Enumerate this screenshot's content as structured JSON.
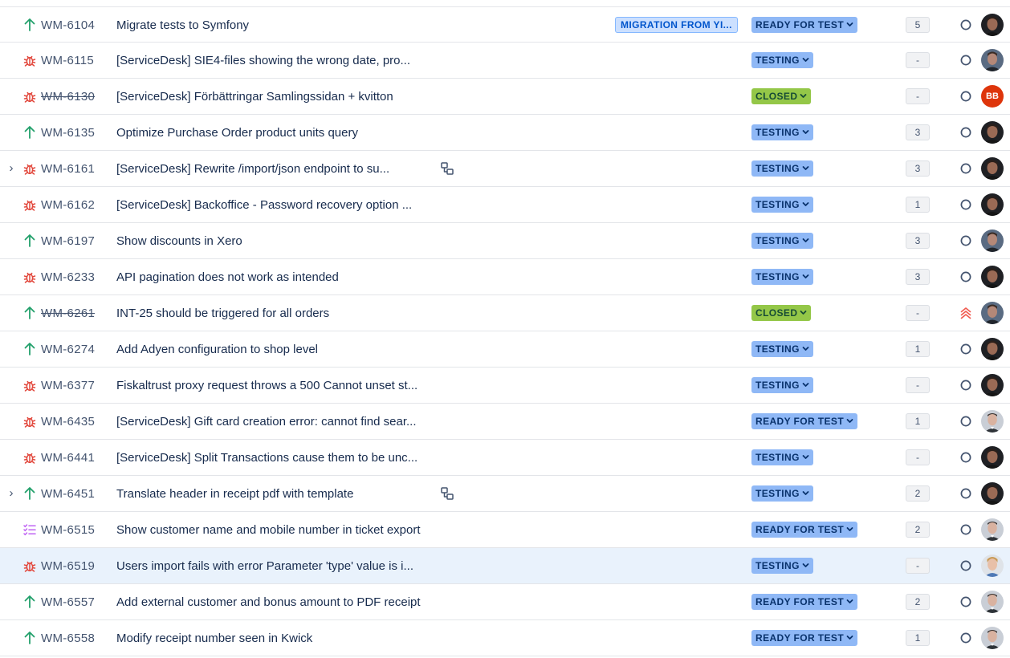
{
  "colors": {
    "story": "#22a06b",
    "bug": "#e2483d",
    "subtask": "#bf63f3",
    "status_blue": "#8fb8f6",
    "status_green": "#94c748",
    "priority_highest": "#f15b50",
    "label_bg": "#cce0ff",
    "selected_row": "#e9f2fc"
  },
  "icons": {
    "expand": "chevron-right-icon",
    "story": "arrow-up-icon",
    "bug": "bug-icon",
    "subtask": "checklist-icon",
    "child_issues": "child-issues-icon",
    "priority_medium": "circle-outline-icon",
    "priority_highest": "double-chevron-up-icon",
    "status_dropdown": "chevron-down-icon"
  },
  "issues": [
    {
      "key": "WM-6104",
      "type": "story",
      "summary": "Migrate tests to Symfony",
      "label": "MIGRATION FROM YI...",
      "status": "READY FOR TEST",
      "status_color": "blue",
      "estimate": "5",
      "priority": "medium",
      "avatar": "dark",
      "done": false,
      "expandable": false,
      "child_icon": false,
      "selected": false
    },
    {
      "key": "WM-6115",
      "type": "bug",
      "summary": "[ServiceDesk] SIE4-files showing the wrong date, pro...",
      "label": "",
      "status": "TESTING",
      "status_color": "blue",
      "estimate": "-",
      "priority": "medium",
      "avatar": "grey",
      "done": false,
      "expandable": false,
      "child_icon": false,
      "selected": false
    },
    {
      "key": "WM-6130",
      "type": "bug",
      "summary": "[ServiceDesk] Förbättringar Samlingssidan + kvitton",
      "label": "",
      "status": "CLOSED",
      "status_color": "green",
      "estimate": "-",
      "priority": "medium",
      "avatar": "initials",
      "initials": "BB",
      "done": true,
      "expandable": false,
      "child_icon": false,
      "selected": false
    },
    {
      "key": "WM-6135",
      "type": "story",
      "summary": "Optimize Purchase Order product units query",
      "label": "",
      "status": "TESTING",
      "status_color": "blue",
      "estimate": "3",
      "priority": "medium",
      "avatar": "dark",
      "done": false,
      "expandable": false,
      "child_icon": false,
      "selected": false
    },
    {
      "key": "WM-6161",
      "type": "bug",
      "summary": "[ServiceDesk] Rewrite /import/json endpoint to su...",
      "label": "",
      "status": "TESTING",
      "status_color": "blue",
      "estimate": "3",
      "priority": "medium",
      "avatar": "dark",
      "done": false,
      "expandable": true,
      "child_icon": true,
      "selected": false
    },
    {
      "key": "WM-6162",
      "type": "bug",
      "summary": "[ServiceDesk] Backoffice - Password recovery option ...",
      "label": "",
      "status": "TESTING",
      "status_color": "blue",
      "estimate": "1",
      "priority": "medium",
      "avatar": "dark",
      "done": false,
      "expandable": false,
      "child_icon": false,
      "selected": false
    },
    {
      "key": "WM-6197",
      "type": "story",
      "summary": "Show discounts in Xero",
      "label": "",
      "status": "TESTING",
      "status_color": "blue",
      "estimate": "3",
      "priority": "medium",
      "avatar": "grey",
      "done": false,
      "expandable": false,
      "child_icon": false,
      "selected": false
    },
    {
      "key": "WM-6233",
      "type": "bug",
      "summary": "API pagination does not work as intended",
      "label": "",
      "status": "TESTING",
      "status_color": "blue",
      "estimate": "3",
      "priority": "medium",
      "avatar": "dark",
      "done": false,
      "expandable": false,
      "child_icon": false,
      "selected": false
    },
    {
      "key": "WM-6261",
      "type": "story",
      "summary": "INT-25 should be triggered for all orders",
      "label": "",
      "status": "CLOSED",
      "status_color": "green",
      "estimate": "-",
      "priority": "highest",
      "avatar": "grey",
      "done": true,
      "expandable": false,
      "child_icon": false,
      "selected": false
    },
    {
      "key": "WM-6274",
      "type": "story",
      "summary": "Add Adyen configuration to shop level",
      "label": "",
      "status": "TESTING",
      "status_color": "blue",
      "estimate": "1",
      "priority": "medium",
      "avatar": "dark",
      "done": false,
      "expandable": false,
      "child_icon": false,
      "selected": false
    },
    {
      "key": "WM-6377",
      "type": "bug",
      "summary": "Fiskaltrust proxy request throws a 500 Cannot unset st...",
      "label": "",
      "status": "TESTING",
      "status_color": "blue",
      "estimate": "-",
      "priority": "medium",
      "avatar": "dark",
      "done": false,
      "expandable": false,
      "child_icon": false,
      "selected": false
    },
    {
      "key": "WM-6435",
      "type": "bug",
      "summary": "[ServiceDesk] Gift card creation error: cannot find sear...",
      "label": "",
      "status": "READY FOR TEST",
      "status_color": "blue",
      "estimate": "1",
      "priority": "medium",
      "avatar": "light",
      "done": false,
      "expandable": false,
      "child_icon": false,
      "selected": false
    },
    {
      "key": "WM-6441",
      "type": "bug",
      "summary": "[ServiceDesk] Split Transactions cause them to be unc...",
      "label": "",
      "status": "TESTING",
      "status_color": "blue",
      "estimate": "-",
      "priority": "medium",
      "avatar": "dark",
      "done": false,
      "expandable": false,
      "child_icon": false,
      "selected": false
    },
    {
      "key": "WM-6451",
      "type": "story",
      "summary": "Translate header in receipt pdf with template",
      "label": "",
      "status": "TESTING",
      "status_color": "blue",
      "estimate": "2",
      "priority": "medium",
      "avatar": "dark",
      "done": false,
      "expandable": true,
      "child_icon": true,
      "selected": false
    },
    {
      "key": "WM-6515",
      "type": "subtask",
      "summary": "Show customer name and mobile number in ticket export",
      "label": "",
      "status": "READY FOR TEST",
      "status_color": "blue",
      "estimate": "2",
      "priority": "medium",
      "avatar": "light",
      "done": false,
      "expandable": false,
      "child_icon": false,
      "selected": false
    },
    {
      "key": "WM-6519",
      "type": "bug",
      "summary": "Users import fails with error Parameter 'type' value is i...",
      "label": "",
      "status": "TESTING",
      "status_color": "blue",
      "estimate": "-",
      "priority": "medium",
      "avatar": "blonde",
      "done": false,
      "expandable": false,
      "child_icon": false,
      "selected": true
    },
    {
      "key": "WM-6557",
      "type": "story",
      "summary": "Add external customer and bonus amount to PDF receipt",
      "label": "",
      "status": "READY FOR TEST",
      "status_color": "blue",
      "estimate": "2",
      "priority": "medium",
      "avatar": "light",
      "done": false,
      "expandable": false,
      "child_icon": false,
      "selected": false
    },
    {
      "key": "WM-6558",
      "type": "story",
      "summary": "Modify receipt number seen in Kwick",
      "label": "",
      "status": "READY FOR TEST",
      "status_color": "blue",
      "estimate": "1",
      "priority": "medium",
      "avatar": "light",
      "done": false,
      "expandable": false,
      "child_icon": false,
      "selected": false
    }
  ]
}
